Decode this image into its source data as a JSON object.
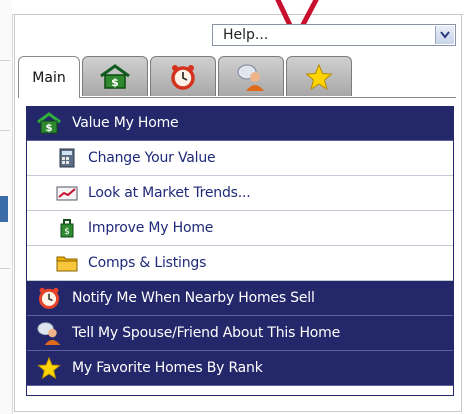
{
  "help_select": {
    "value": "Help...",
    "arrow_icon": "chevron-down-icon"
  },
  "tabs": [
    {
      "label": "Main",
      "icon": null,
      "active": true
    },
    {
      "label": "",
      "icon": "money-house-icon",
      "active": false
    },
    {
      "label": "",
      "icon": "alarm-clock-icon",
      "active": false
    },
    {
      "label": "",
      "icon": "people-chat-icon",
      "active": false
    },
    {
      "label": "",
      "icon": "star-icon",
      "active": false
    }
  ],
  "menu": {
    "items": [
      {
        "label": "Value My Home",
        "icon": "money-house-icon",
        "style": "dark"
      },
      {
        "label": "Change Your Value",
        "icon": "calculator-icon",
        "style": "light"
      },
      {
        "label": "Look at Market Trends...",
        "icon": "chart-icon",
        "style": "light"
      },
      {
        "label": "Improve My Home",
        "icon": "tools-icon",
        "style": "light"
      },
      {
        "label": "Comps & Listings",
        "icon": "folder-icon",
        "style": "light"
      },
      {
        "label": "Notify Me When Nearby Homes Sell",
        "icon": "alarm-clock-icon",
        "style": "dark"
      },
      {
        "label": "Tell My Spouse/Friend About This Home",
        "icon": "people-chat-icon",
        "style": "dark"
      },
      {
        "label": "My Favorite Homes By Rank",
        "icon": "star-icon",
        "style": "dark"
      }
    ]
  },
  "colors": {
    "menu_dark": "#24286a",
    "link_text": "#1f2a7a",
    "arrow": "#c8102e"
  }
}
